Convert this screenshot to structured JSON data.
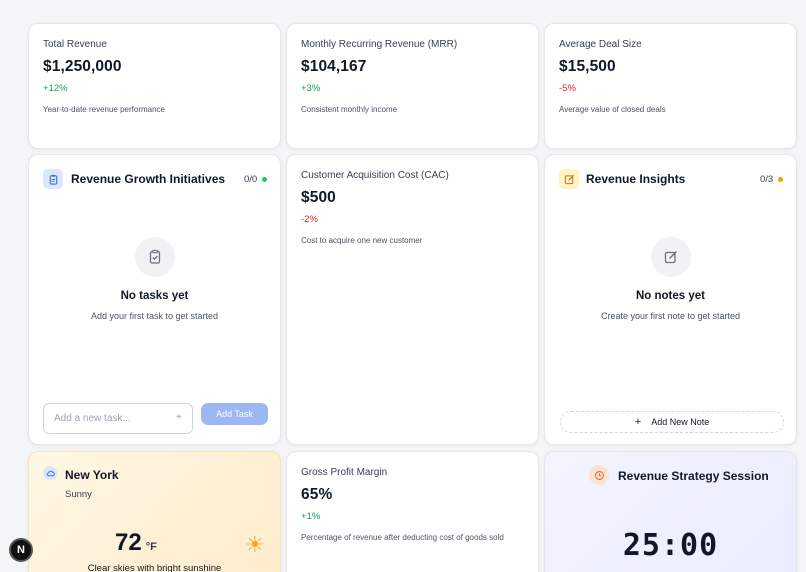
{
  "metrics": {
    "total_revenue": {
      "label": "Total Revenue",
      "value": "$1,250,000",
      "change": "+12%",
      "description": "Year-to-date revenue performance"
    },
    "mrr": {
      "label": "Monthly Recurring Revenue (MRR)",
      "value": "$104,167",
      "change": "+3%",
      "description": "Consistent monthly income"
    },
    "avg_deal": {
      "label": "Average Deal Size",
      "value": "$15,500",
      "change": "-5%",
      "description": "Average value of closed deals"
    },
    "cac": {
      "label": "Customer Acquisition Cost (CAC)",
      "value": "$500",
      "change": "-2%",
      "description": "Cost to acquire one new customer"
    },
    "gross_margin": {
      "label": "Gross Profit Margin",
      "value": "65%",
      "change": "+1%",
      "description": "Percentage of revenue after deducting cost of goods sold"
    }
  },
  "tasks": {
    "title": "Revenue Growth Initiatives",
    "count": "0/0",
    "empty_title": "No tasks yet",
    "empty_subtitle": "Add your first task to get started",
    "input_placeholder": "Add a new task...",
    "plus": "+",
    "add_button": "Add Task",
    "icon": "clipboard-icon"
  },
  "notes": {
    "title": "Revenue Insights",
    "count": "0/3",
    "empty_title": "No notes yet",
    "empty_subtitle": "Create your first note to get started",
    "add_button": "Add New Note",
    "plus": "+",
    "icon": "edit-note-icon"
  },
  "weather": {
    "city": "New York",
    "condition": "Sunny",
    "temperature": "72",
    "unit": "°F",
    "description": "Clear skies with bright sunshine",
    "sun": "☀",
    "icon": "cloud-icon"
  },
  "timer": {
    "title": "Revenue Strategy Session",
    "time": "25:00",
    "icon": "clock-icon"
  },
  "fab": {
    "label": "N"
  },
  "colors": {
    "positive": "#16a34a",
    "negative": "#dc2626",
    "accent_blue": "#9db7f5",
    "status_green": "#22c55e",
    "status_amber": "#f59e0b"
  }
}
